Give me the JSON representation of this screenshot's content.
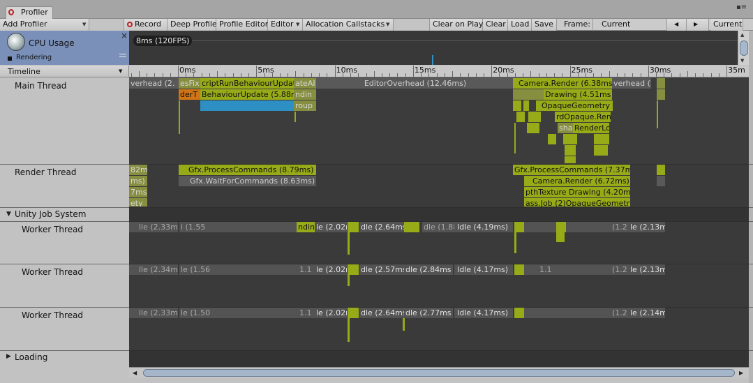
{
  "window": {
    "tab_title": "Profiler",
    "menu_glyph": "▪≡"
  },
  "toolbar": {
    "add_profiler": "Add Profiler",
    "record": "Record",
    "deep_profile": "Deep Profile",
    "profile_editor": "Profile Editor",
    "editor": "Editor",
    "allocation_callstacks": "Allocation Callstacks",
    "clear_on_play": "Clear on Play",
    "clear": "Clear",
    "load": "Load",
    "save": "Save",
    "frame_label": "Frame:",
    "frame_value": "Current",
    "prev": "◀",
    "next": "▶",
    "current": "Current"
  },
  "cpu_module": {
    "title": "CPU Usage",
    "legend_first": "Rendering",
    "close": "×",
    "fps_label": "8ms (120FPS)"
  },
  "timeline": {
    "view_label": "Timeline",
    "ruler": [
      "0ms",
      "5ms",
      "10ms",
      "15ms",
      "20ms",
      "25ms",
      "30ms",
      "35m"
    ]
  },
  "threads": {
    "main": "Main Thread",
    "render": "Render Thread",
    "job_group": "Unity Job System",
    "worker1": "Worker Thread",
    "worker2": "Worker Thread",
    "worker3": "Worker Thread",
    "loading": "Loading"
  },
  "markers": {
    "m_overhead_left": "verhead (2.",
    "m_fixed": "esFix",
    "m_script_run": "criptRunBehaviourUpdate",
    "m_late": "ateAI",
    "m_editor_overhead": "EditorOverhead (12.46ms)",
    "m_camera_render": "Camera.Render (6.38ms)",
    "m_overhead_right": "verhead (2.",
    "m_render_t": "derT",
    "m_behaviour_update": "BehaviourUpdate (5.88ms)",
    "m_ndin": "ndin",
    "m_drawing": "Drawing (4.51ms)",
    "m_roup": "roup",
    "m_opaque_geometry": "OpaqueGeometry (4",
    "m_rd_opaque": "rdOpaque.Rend",
    "m_shad": "shad",
    "m_render_lo": "RenderLo",
    "r_left1": "82ms",
    "r_gfx_process1": "Gfx.ProcessCommands (8.79ms)",
    "r_gfx_process2": "Gfx.ProcessCommands (7.37ms)",
    "r_left2": "ms)",
    "r_gfx_wait": "Gfx.WaitForCommands (8.63ms)",
    "r_camera_render": "Camera.Render (6.72ms)",
    "r_left3": "7ms",
    "r_depth_texture": "pthTexture Drawing (4.20ms)",
    "r_left4": "ety",
    "r_pass_job": "ass.Job (2)OpaqueGeometry (",
    "w1": [
      "lle (2.33m",
      "i (1.55",
      "ndinle",
      "le (2.02m",
      "dle (2.64ms",
      "dle (1.88m",
      "Idle (4.19ms)",
      "(1.2",
      "le (2.13m"
    ],
    "w2": [
      "lle (2.34m",
      "le (1.56",
      "1.1",
      "le (2.02m",
      "dle (2.57ms",
      "dle (2.84ms",
      "Idle (4.17ms)",
      "1.1",
      "(1.2",
      "le (2.13m"
    ],
    "w3": [
      "lle (2.33m",
      "le (1.50",
      "1.1",
      "le (2.02m",
      "dle (2.64ms",
      "dle (2.77ms",
      "Idle (4.17ms)",
      "(1.2",
      "le (2.14m"
    ]
  },
  "colors": {
    "accent_green": "#97ab18",
    "script_blue": "#2d8fc4",
    "render_orange": "#d07416",
    "module_blue": "#7a90b8"
  }
}
